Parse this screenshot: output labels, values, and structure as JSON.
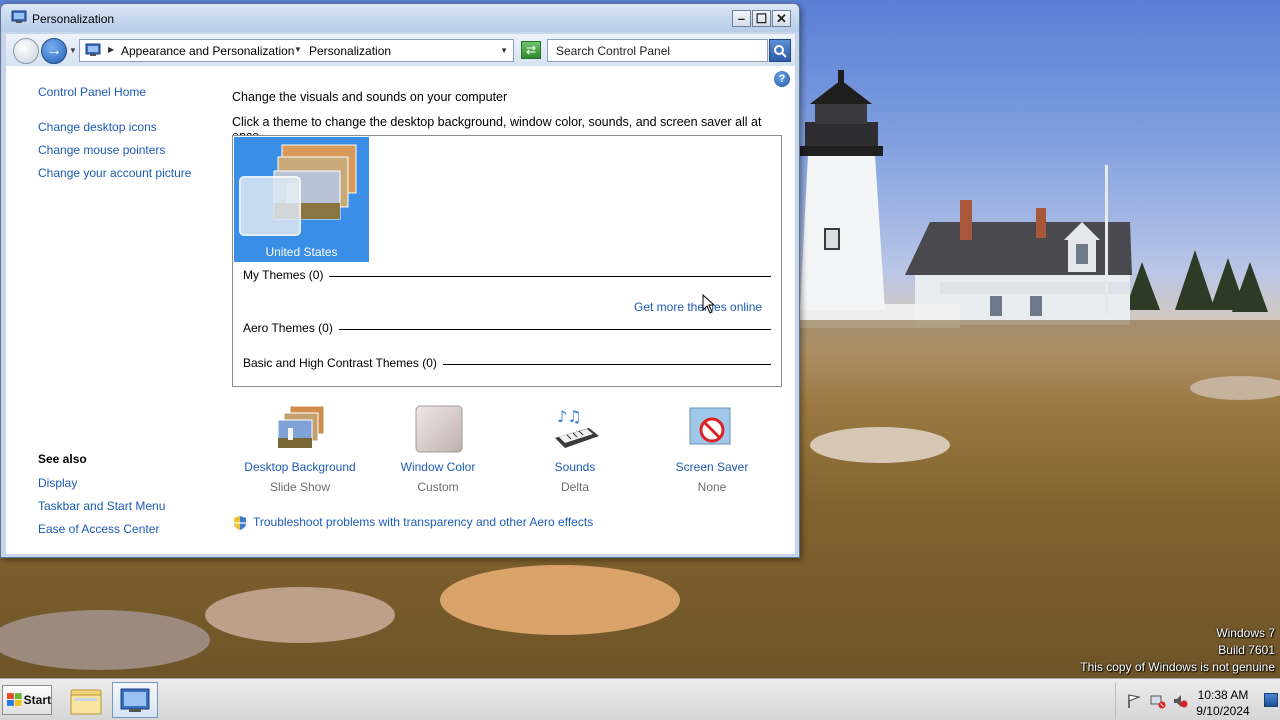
{
  "window": {
    "title": "Personalization",
    "min_icon": "minimize-icon",
    "max_icon": "maximize-icon",
    "close_icon": "close-icon"
  },
  "navigation": {
    "crumbs": [
      "Appearance and Personalization",
      "Personalization"
    ],
    "search_placeholder": "Search Control Panel"
  },
  "sidebar": {
    "home": "Control Panel Home",
    "links": [
      "Change desktop icons",
      "Change mouse pointers",
      "Change your account picture"
    ],
    "see_also_title": "See also",
    "see_also": [
      "Display",
      "Taskbar and Start Menu",
      "Ease of Access Center"
    ]
  },
  "main": {
    "heading": "Change the visuals and sounds on your computer",
    "subheading": "Click a theme to change the desktop background, window color, sounds, and screen saver all at once.",
    "selected_theme": "United States",
    "groups": {
      "my_themes": "My Themes (0)",
      "aero_themes": "Aero Themes (0)",
      "basic_themes": "Basic and High Contrast Themes (0)"
    },
    "get_more": "Get more themes online",
    "items": [
      {
        "title": "Desktop Background",
        "sub": "Slide Show",
        "icon": "desktop-background-icon"
      },
      {
        "title": "Window Color",
        "sub": "Custom",
        "icon": "window-color-icon"
      },
      {
        "title": "Sounds",
        "sub": "Delta",
        "icon": "sounds-icon"
      },
      {
        "title": "Screen Saver",
        "sub": "None",
        "icon": "screen-saver-icon"
      }
    ],
    "troubleshoot": "Troubleshoot problems with transparency and other Aero effects"
  },
  "desktop": {
    "watermark": [
      "Windows 7",
      "Build 7601",
      "This copy of Windows is not genuine"
    ]
  },
  "taskbar": {
    "start_label": "Start",
    "time": "10:38 AM",
    "date": "9/10/2024"
  },
  "colors": {
    "link": "#1c5bb5",
    "selection": "#3a8ee6",
    "window_frame": "#c7d5ea"
  }
}
